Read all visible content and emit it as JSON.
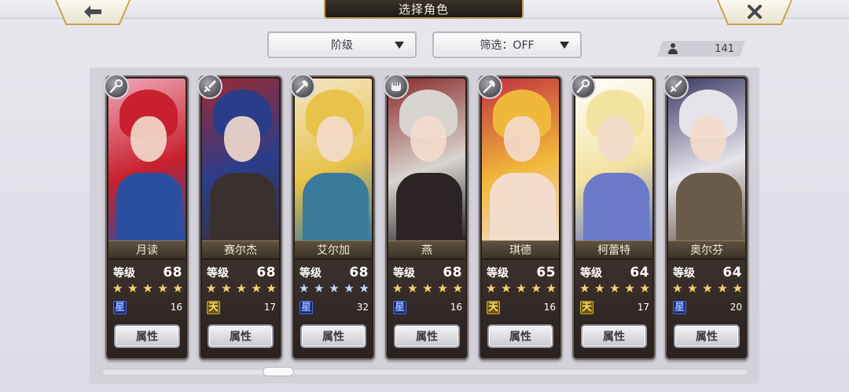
{
  "header": {
    "title": "选择角色",
    "back_icon": "back-arrow-icon",
    "close_icon": "close-x-icon"
  },
  "filters": {
    "tier_label": "阶级",
    "filter_label": "筛选：OFF"
  },
  "count": {
    "value": "141",
    "icon": "person-icon"
  },
  "labels": {
    "level": "等级",
    "attribute_button": "属性"
  },
  "characters": [
    {
      "name": "月读",
      "level": "68",
      "stars": 5,
      "star_color": "gold",
      "element_icon": "star-element-icon",
      "element_glyph": "星",
      "count": "16",
      "class_icon": "staff-class-icon",
      "palette": [
        "#c8202e",
        "#f0a8b8",
        "#2a4fa0"
      ]
    },
    {
      "name": "赛尔杰",
      "level": "68",
      "stars": 5,
      "star_color": "gold",
      "element_icon": "sky-element-icon",
      "element_glyph": "天",
      "count": "17",
      "class_icon": "sword-class-icon",
      "palette": [
        "#2b3d8a",
        "#9a2a32",
        "#3a3030"
      ]
    },
    {
      "name": "艾尔加",
      "level": "68",
      "stars": 5,
      "star_color": "blue",
      "element_icon": "star-element-icon",
      "element_glyph": "星",
      "count": "32",
      "class_icon": "axe-class-icon",
      "palette": [
        "#e8c24a",
        "#f3e6c6",
        "#3a7a9a"
      ]
    },
    {
      "name": "燕",
      "level": "68",
      "stars": 5,
      "star_color": "gold",
      "element_icon": "star-element-icon",
      "element_glyph": "星",
      "count": "16",
      "class_icon": "fist-class-icon",
      "palette": [
        "#d8d4d0",
        "#8a2a2a",
        "#2c2424"
      ]
    },
    {
      "name": "琪德",
      "level": "65",
      "stars": 5,
      "star_color": "gold",
      "element_icon": "sky-element-icon",
      "element_glyph": "天",
      "count": "16",
      "class_icon": "axe-class-icon",
      "palette": [
        "#f0b83a",
        "#c23040",
        "#f3dccc"
      ]
    },
    {
      "name": "柯蕾特",
      "level": "64",
      "stars": 5,
      "star_color": "gold",
      "element_icon": "sky-element-icon",
      "element_glyph": "天",
      "count": "17",
      "class_icon": "staff-class-icon",
      "palette": [
        "#f3e3a0",
        "#ffffff",
        "#6a7ac8"
      ]
    },
    {
      "name": "奥尔芬",
      "level": "64",
      "stars": 5,
      "star_color": "gold",
      "element_icon": "star-element-icon",
      "element_glyph": "星",
      "count": "20",
      "class_icon": "sword-class-icon",
      "palette": [
        "#e6e4ea",
        "#3c3a64",
        "#6a5a4a"
      ]
    }
  ],
  "colors": {
    "accent_gold": "#c7a24d",
    "panel": "#d3d1d9",
    "card_dark": "#29211f"
  }
}
